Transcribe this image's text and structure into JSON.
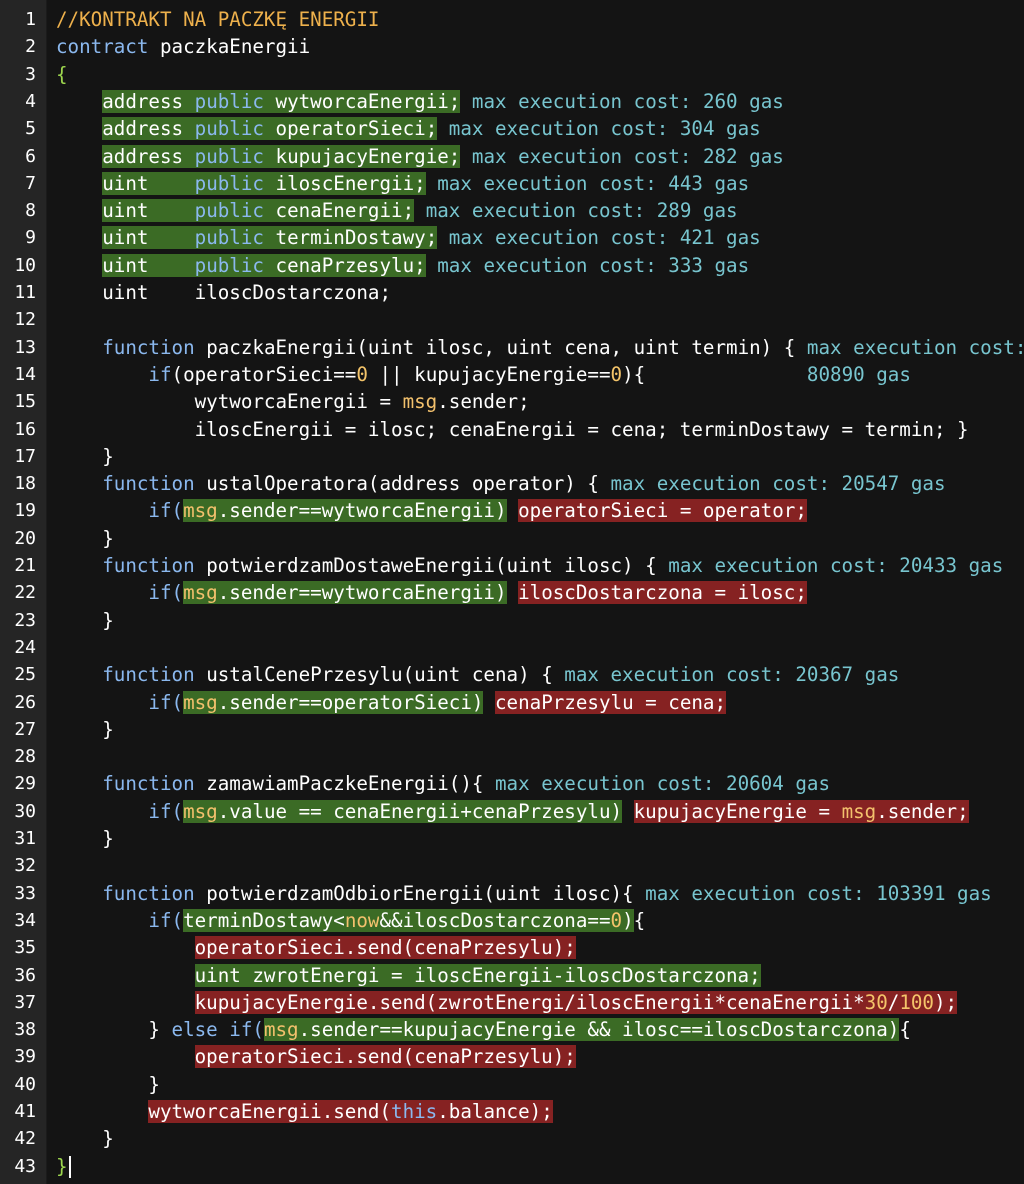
{
  "editor": {
    "lines": [
      {
        "n": "1",
        "t": [
          [
            "//KONTRAKT NA PACZKĘ ENERGII",
            "comment",
            ""
          ]
        ]
      },
      {
        "n": "2",
        "t": [
          [
            "contract ",
            "kw",
            ""
          ],
          [
            "paczkaEnergii",
            "id",
            ""
          ]
        ]
      },
      {
        "n": "3",
        "t": [
          [
            "{",
            "green-brace",
            ""
          ]
        ]
      },
      {
        "n": "4",
        "t": [
          [
            "    ",
            "id",
            ""
          ],
          [
            "address ",
            "type",
            "g"
          ],
          [
            "public ",
            "kw",
            "g"
          ],
          [
            "wytworcaEnergii;",
            "id",
            "g"
          ],
          [
            " max execution cost: 260 gas",
            "gas",
            ""
          ]
        ]
      },
      {
        "n": "5",
        "t": [
          [
            "    ",
            "id",
            ""
          ],
          [
            "address ",
            "type",
            "g"
          ],
          [
            "public ",
            "kw",
            "g"
          ],
          [
            "operatorSieci;",
            "id",
            "g"
          ],
          [
            " max execution cost: 304 gas",
            "gas",
            ""
          ]
        ]
      },
      {
        "n": "6",
        "t": [
          [
            "    ",
            "id",
            ""
          ],
          [
            "address ",
            "type",
            "g"
          ],
          [
            "public ",
            "kw",
            "g"
          ],
          [
            "kupujacyEnergie;",
            "id",
            "g"
          ],
          [
            " max execution cost: 282 gas",
            "gas",
            ""
          ]
        ]
      },
      {
        "n": "7",
        "t": [
          [
            "    ",
            "id",
            ""
          ],
          [
            "uint    ",
            "type",
            "g"
          ],
          [
            "public ",
            "kw",
            "g"
          ],
          [
            "iloscEnergii;",
            "id",
            "g"
          ],
          [
            " max execution cost: 443 gas",
            "gas",
            ""
          ]
        ]
      },
      {
        "n": "8",
        "t": [
          [
            "    ",
            "id",
            ""
          ],
          [
            "uint    ",
            "type",
            "g"
          ],
          [
            "public ",
            "kw",
            "g"
          ],
          [
            "cenaEnergii;",
            "id",
            "g"
          ],
          [
            " max execution cost: 289 gas",
            "gas",
            ""
          ]
        ]
      },
      {
        "n": "9",
        "t": [
          [
            "    ",
            "id",
            ""
          ],
          [
            "uint    ",
            "type",
            "g"
          ],
          [
            "public ",
            "kw",
            "g"
          ],
          [
            "terminDostawy;",
            "id",
            "g"
          ],
          [
            " max execution cost: 421 gas",
            "gas",
            ""
          ]
        ]
      },
      {
        "n": "10",
        "t": [
          [
            "    ",
            "id",
            ""
          ],
          [
            "uint    ",
            "type",
            "g"
          ],
          [
            "public ",
            "kw",
            "g"
          ],
          [
            "cenaPrzesylu;",
            "id",
            "g"
          ],
          [
            " max execution cost: 333 gas",
            "gas",
            ""
          ]
        ]
      },
      {
        "n": "11",
        "t": [
          [
            "    ",
            "id",
            ""
          ],
          [
            "uint    ",
            "type",
            ""
          ],
          [
            "iloscDostarczona;",
            "id",
            ""
          ]
        ]
      },
      {
        "n": "12",
        "t": []
      },
      {
        "n": "13",
        "t": [
          [
            "    ",
            "id",
            ""
          ],
          [
            "function ",
            "kw",
            ""
          ],
          [
            "paczkaEnergii(uint ilosc, uint cena, uint termin) {",
            "id",
            ""
          ],
          [
            " max execution cost:",
            "gas",
            ""
          ]
        ]
      },
      {
        "n": "14",
        "t": [
          [
            "        ",
            "id",
            ""
          ],
          [
            "if",
            "kw",
            ""
          ],
          [
            "(operatorSieci==",
            "id",
            ""
          ],
          [
            "0",
            "num",
            ""
          ],
          [
            " || kupujacyEnergie==",
            "id",
            ""
          ],
          [
            "0",
            "num",
            ""
          ],
          [
            "){",
            "id",
            ""
          ],
          [
            "              80890 gas",
            "gas",
            ""
          ]
        ]
      },
      {
        "n": "15",
        "t": [
          [
            "            ",
            "id",
            ""
          ],
          [
            "wytworcaEnergii = ",
            "id",
            ""
          ],
          [
            "msg",
            "obj",
            ""
          ],
          [
            ".sender;",
            "id",
            ""
          ]
        ]
      },
      {
        "n": "16",
        "t": [
          [
            "            ",
            "id",
            ""
          ],
          [
            "iloscEnergii = ilosc; cenaEnergii = cena; terminDostawy = termin; }",
            "id",
            ""
          ]
        ]
      },
      {
        "n": "17",
        "t": [
          [
            "    ",
            "id",
            ""
          ],
          [
            "}",
            "id",
            ""
          ]
        ]
      },
      {
        "n": "18",
        "t": [
          [
            "    ",
            "id",
            ""
          ],
          [
            "function ",
            "kw",
            ""
          ],
          [
            "ustalOperatora(address operator) {",
            "id",
            ""
          ],
          [
            " max execution cost: 20547 gas",
            "gas",
            ""
          ]
        ]
      },
      {
        "n": "19",
        "t": [
          [
            "        ",
            "id",
            ""
          ],
          [
            "if(",
            "kw",
            ""
          ],
          [
            "msg",
            "obj",
            "g"
          ],
          [
            ".sender==wytworcaEnergii)",
            "id",
            "g"
          ],
          [
            " ",
            "id",
            ""
          ],
          [
            "operatorSieci = operator;",
            "id",
            "r"
          ]
        ]
      },
      {
        "n": "20",
        "t": [
          [
            "    ",
            "id",
            ""
          ],
          [
            "}",
            "id",
            ""
          ]
        ]
      },
      {
        "n": "21",
        "t": [
          [
            "    ",
            "id",
            ""
          ],
          [
            "function ",
            "kw",
            ""
          ],
          [
            "potwierdzamDostaweEnergii(uint ilosc) {",
            "id",
            ""
          ],
          [
            " max execution cost: 20433 gas",
            "gas",
            ""
          ]
        ]
      },
      {
        "n": "22",
        "t": [
          [
            "        ",
            "id",
            ""
          ],
          [
            "if(",
            "kw",
            ""
          ],
          [
            "msg",
            "obj",
            "g"
          ],
          [
            ".sender==wytworcaEnergii)",
            "id",
            "g"
          ],
          [
            " ",
            "id",
            ""
          ],
          [
            "iloscDostarczona = ilosc;",
            "id",
            "r"
          ]
        ]
      },
      {
        "n": "23",
        "t": [
          [
            "    ",
            "id",
            ""
          ],
          [
            "}",
            "id",
            ""
          ]
        ]
      },
      {
        "n": "24",
        "t": []
      },
      {
        "n": "25",
        "t": [
          [
            "    ",
            "id",
            ""
          ],
          [
            "function ",
            "kw",
            ""
          ],
          [
            "ustalCenePrzesylu(uint cena) {",
            "id",
            ""
          ],
          [
            " max execution cost: 20367 gas",
            "gas",
            ""
          ]
        ]
      },
      {
        "n": "26",
        "t": [
          [
            "        ",
            "id",
            ""
          ],
          [
            "if(",
            "kw",
            ""
          ],
          [
            "msg",
            "obj",
            "g"
          ],
          [
            ".sender==operatorSieci)",
            "id",
            "g"
          ],
          [
            " ",
            "id",
            ""
          ],
          [
            "cenaPrzesylu = cena;",
            "id",
            "r"
          ]
        ]
      },
      {
        "n": "27",
        "t": [
          [
            "    ",
            "id",
            ""
          ],
          [
            "}",
            "id",
            ""
          ]
        ]
      },
      {
        "n": "28",
        "t": []
      },
      {
        "n": "29",
        "t": [
          [
            "    ",
            "id",
            ""
          ],
          [
            "function ",
            "kw",
            ""
          ],
          [
            "zamawiamPaczkeEnergii(){",
            "id",
            ""
          ],
          [
            " max execution cost: 20604 gas",
            "gas",
            ""
          ]
        ]
      },
      {
        "n": "30",
        "t": [
          [
            "        ",
            "id",
            ""
          ],
          [
            "if(",
            "kw",
            ""
          ],
          [
            "msg",
            "obj",
            "g"
          ],
          [
            ".value == cenaEnergii+cenaPrzesylu)",
            "id",
            "g"
          ],
          [
            " ",
            "id",
            ""
          ],
          [
            "kupujacyEnergie = ",
            "id",
            "r"
          ],
          [
            "msg",
            "obj",
            "r"
          ],
          [
            ".sender;",
            "id",
            "r"
          ]
        ]
      },
      {
        "n": "31",
        "t": [
          [
            "    ",
            "id",
            ""
          ],
          [
            "}",
            "id",
            ""
          ]
        ]
      },
      {
        "n": "32",
        "t": []
      },
      {
        "n": "33",
        "t": [
          [
            "    ",
            "id",
            ""
          ],
          [
            "function ",
            "kw",
            ""
          ],
          [
            "potwierdzamOdbiorEnergii(uint ilosc){",
            "id",
            ""
          ],
          [
            " max execution cost: 103391 gas",
            "gas",
            ""
          ]
        ]
      },
      {
        "n": "34",
        "t": [
          [
            "        ",
            "id",
            ""
          ],
          [
            "if(",
            "kw",
            ""
          ],
          [
            "terminDostawy<",
            "id",
            "g"
          ],
          [
            "now",
            "obj",
            "g"
          ],
          [
            "&&iloscDostarczona==",
            "id",
            "g"
          ],
          [
            "0",
            "num",
            "g"
          ],
          [
            ")",
            "id",
            "g"
          ],
          [
            "{",
            "id",
            ""
          ]
        ]
      },
      {
        "n": "35",
        "t": [
          [
            "            ",
            "id",
            ""
          ],
          [
            "operatorSieci.send(cenaPrzesylu);",
            "id",
            "r"
          ]
        ]
      },
      {
        "n": "36",
        "t": [
          [
            "            ",
            "id",
            ""
          ],
          [
            "uint zwrotEnergi = iloscEnergii-iloscDostarczona;",
            "id",
            "g"
          ]
        ]
      },
      {
        "n": "37",
        "t": [
          [
            "            ",
            "id",
            ""
          ],
          [
            "kupujacyEnergie.send(zwrotEnergi/iloscEnergii*cenaEnergii*",
            "id",
            "r"
          ],
          [
            "30",
            "num",
            "r"
          ],
          [
            "/",
            "id",
            "r"
          ],
          [
            "100",
            "num",
            "r"
          ],
          [
            ");",
            "id",
            "r"
          ]
        ]
      },
      {
        "n": "38",
        "t": [
          [
            "        ",
            "id",
            ""
          ],
          [
            "} ",
            "id",
            ""
          ],
          [
            "else if(",
            "kw",
            ""
          ],
          [
            "msg",
            "obj",
            "g"
          ],
          [
            ".sender==kupujacyEnergie && ilosc==iloscDostarczona)",
            "id",
            "g"
          ],
          [
            "{",
            "id",
            ""
          ]
        ]
      },
      {
        "n": "39",
        "t": [
          [
            "            ",
            "id",
            ""
          ],
          [
            "operatorSieci.send(cenaPrzesylu);",
            "id",
            "r"
          ]
        ]
      },
      {
        "n": "40",
        "t": [
          [
            "        ",
            "id",
            ""
          ],
          [
            "}",
            "id",
            ""
          ]
        ]
      },
      {
        "n": "41",
        "t": [
          [
            "        ",
            "id",
            ""
          ],
          [
            "wytworcaEnergii.send(",
            "id",
            "r"
          ],
          [
            "this",
            "kw",
            "r"
          ],
          [
            ".balance);",
            "id",
            "r"
          ]
        ]
      },
      {
        "n": "42",
        "t": [
          [
            "    ",
            "id",
            ""
          ],
          [
            "}",
            "id",
            ""
          ]
        ]
      },
      {
        "n": "43",
        "t": [
          [
            "}",
            "green-brace",
            ""
          ]
        ]
      }
    ]
  },
  "colors": {
    "background": "#141414",
    "gutter": "#252525",
    "covered_green": "#3b6b25",
    "uncovered_red": "#862222",
    "comment": "#eeb14c",
    "keyword": "#8bb8ee",
    "gas_annotation": "#78c5cf"
  }
}
